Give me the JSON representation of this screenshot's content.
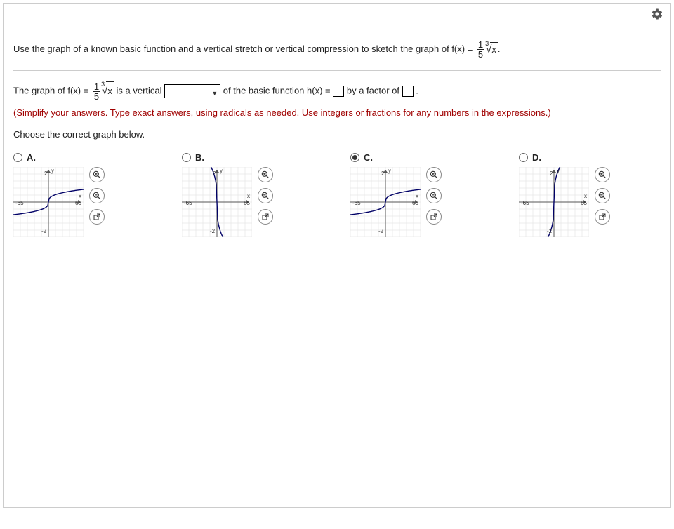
{
  "question": {
    "prefix": "Use the graph of a known basic function and a vertical stretch or vertical compression to sketch the graph of f(x) = ",
    "frac_num": "1",
    "frac_den": "5",
    "root_index": "3",
    "radicand": "x",
    "suffix": "."
  },
  "answerline": {
    "p1": "The graph of f(x) = ",
    "frac_num": "1",
    "frac_den": "5",
    "root_index": "3",
    "radicand": "x",
    "p2": " is a vertical ",
    "p3": " of the basic function h(x) = ",
    "p4": " by a factor of ",
    "p5": "."
  },
  "hint": "(Simplify your answers. Type exact answers, using radicals as needed. Use integers or fractions for any numbers in the expressions.)",
  "instruct": "Choose the correct graph below.",
  "choices": [
    {
      "label": "A.",
      "selected": false,
      "type": "compressed",
      "reflect": false
    },
    {
      "label": "B.",
      "selected": false,
      "type": "normal",
      "reflect": true
    },
    {
      "label": "C.",
      "selected": true,
      "type": "compressed",
      "reflect": false
    },
    {
      "label": "D.",
      "selected": false,
      "type": "normal",
      "reflect": false
    }
  ],
  "axes": {
    "xmin": "-65",
    "xmax": "65",
    "ymin": "-2",
    "ymax": "2",
    "xlabel": "x",
    "ylabel": "y"
  },
  "icons": {
    "zoomin": "⊕",
    "zoomout": "⊖",
    "popout": "⇱"
  }
}
